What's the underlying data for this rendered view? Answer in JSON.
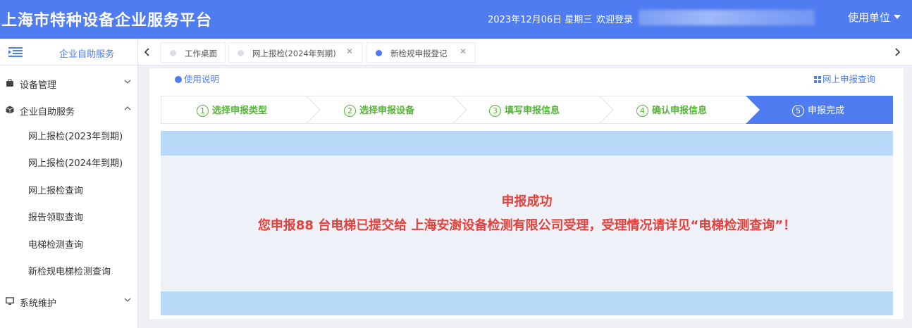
{
  "header": {
    "title": "上海市特种设备企业服务平台",
    "date": "2023年12月06日 星期三",
    "welcome": "欢迎登录",
    "unit_menu": "使用单位"
  },
  "sidebar": {
    "top_title": "企业自助服务",
    "groups": [
      {
        "label": "设备管理",
        "icon": "briefcase-icon",
        "expanded": false
      },
      {
        "label": "企业自助服务",
        "icon": "cube-icon",
        "expanded": true,
        "items": [
          "网上报检(2023年到期)",
          "网上报检(2024年到期)",
          "网上报检查询",
          "报告领取查询",
          "电梯检测查询",
          "新检规电梯检测查询"
        ]
      },
      {
        "label": "系统维护",
        "icon": "monitor-icon",
        "expanded": false
      }
    ]
  },
  "tabs": [
    {
      "label": "工作桌面",
      "active": false,
      "closable": false
    },
    {
      "label": "网上报检(2024年到期)",
      "active": false,
      "closable": true
    },
    {
      "label": "新检规申报登记",
      "active": true,
      "closable": true
    }
  ],
  "main": {
    "help_link": "使用说明",
    "query_link": "网上申报查询",
    "steps": [
      {
        "num": "1",
        "label": "选择申报类型",
        "state": "done"
      },
      {
        "num": "2",
        "label": "选择申报设备",
        "state": "done"
      },
      {
        "num": "3",
        "label": "填写申报信息",
        "state": "done"
      },
      {
        "num": "4",
        "label": "确认申报信息",
        "state": "done"
      },
      {
        "num": "5",
        "label": "申报完成",
        "state": "current"
      }
    ],
    "result_title": "申报成功",
    "result_message": "您申报88 台电梯已提交给 上海安澍设备检测有限公司受理，受理情况请详见“电梯检测查询”！"
  },
  "colors": {
    "header_bg": "#4f7cf0",
    "accent": "#4f7cf0",
    "step_done": "#52b535",
    "step_current_bg": "#4f7cf0",
    "success_text": "#e5413b",
    "band": "#b8d9f8",
    "tab_active_dot": "#4f7cf0"
  }
}
